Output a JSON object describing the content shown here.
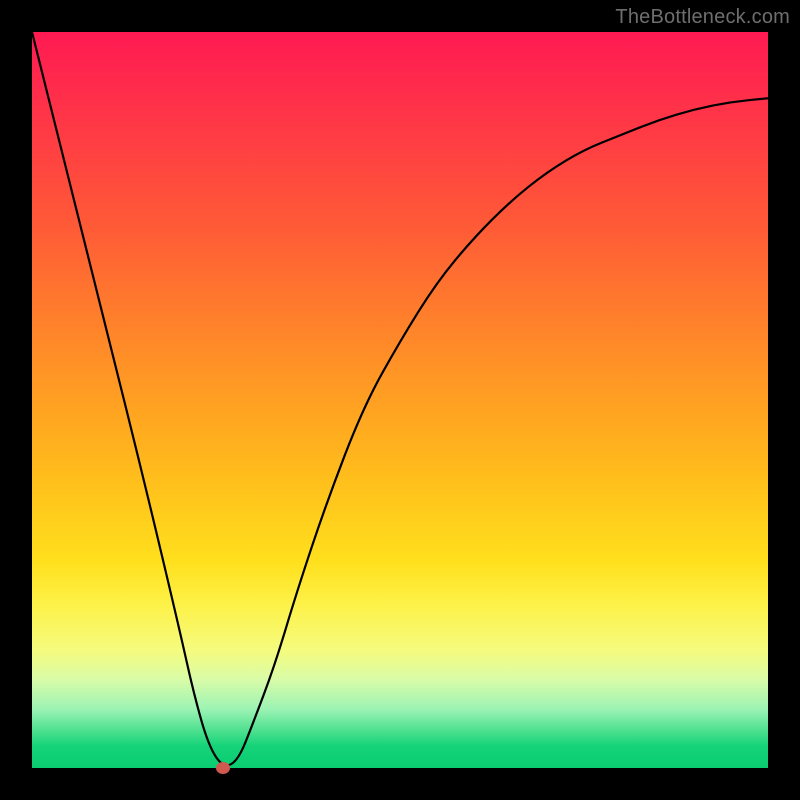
{
  "watermark": "TheBottleneck.com",
  "chart_data": {
    "type": "line",
    "title": "",
    "xlabel": "",
    "ylabel": "",
    "xlim": [
      0,
      100
    ],
    "ylim": [
      0,
      100
    ],
    "grid": false,
    "legend": false,
    "series": [
      {
        "name": "curve",
        "x": [
          0,
          5,
          10,
          15,
          20,
          22,
          24,
          26,
          28,
          30,
          33,
          36,
          40,
          45,
          50,
          55,
          60,
          65,
          70,
          75,
          80,
          85,
          90,
          95,
          100
        ],
        "y": [
          100,
          80,
          60,
          40,
          19,
          10,
          3,
          0,
          1,
          6,
          14,
          24,
          36,
          49,
          58,
          66,
          72,
          77,
          81,
          84,
          86,
          88,
          89.5,
          90.5,
          91
        ]
      }
    ],
    "marker": {
      "x": 26,
      "y": 0,
      "color": "#d0594f"
    }
  }
}
